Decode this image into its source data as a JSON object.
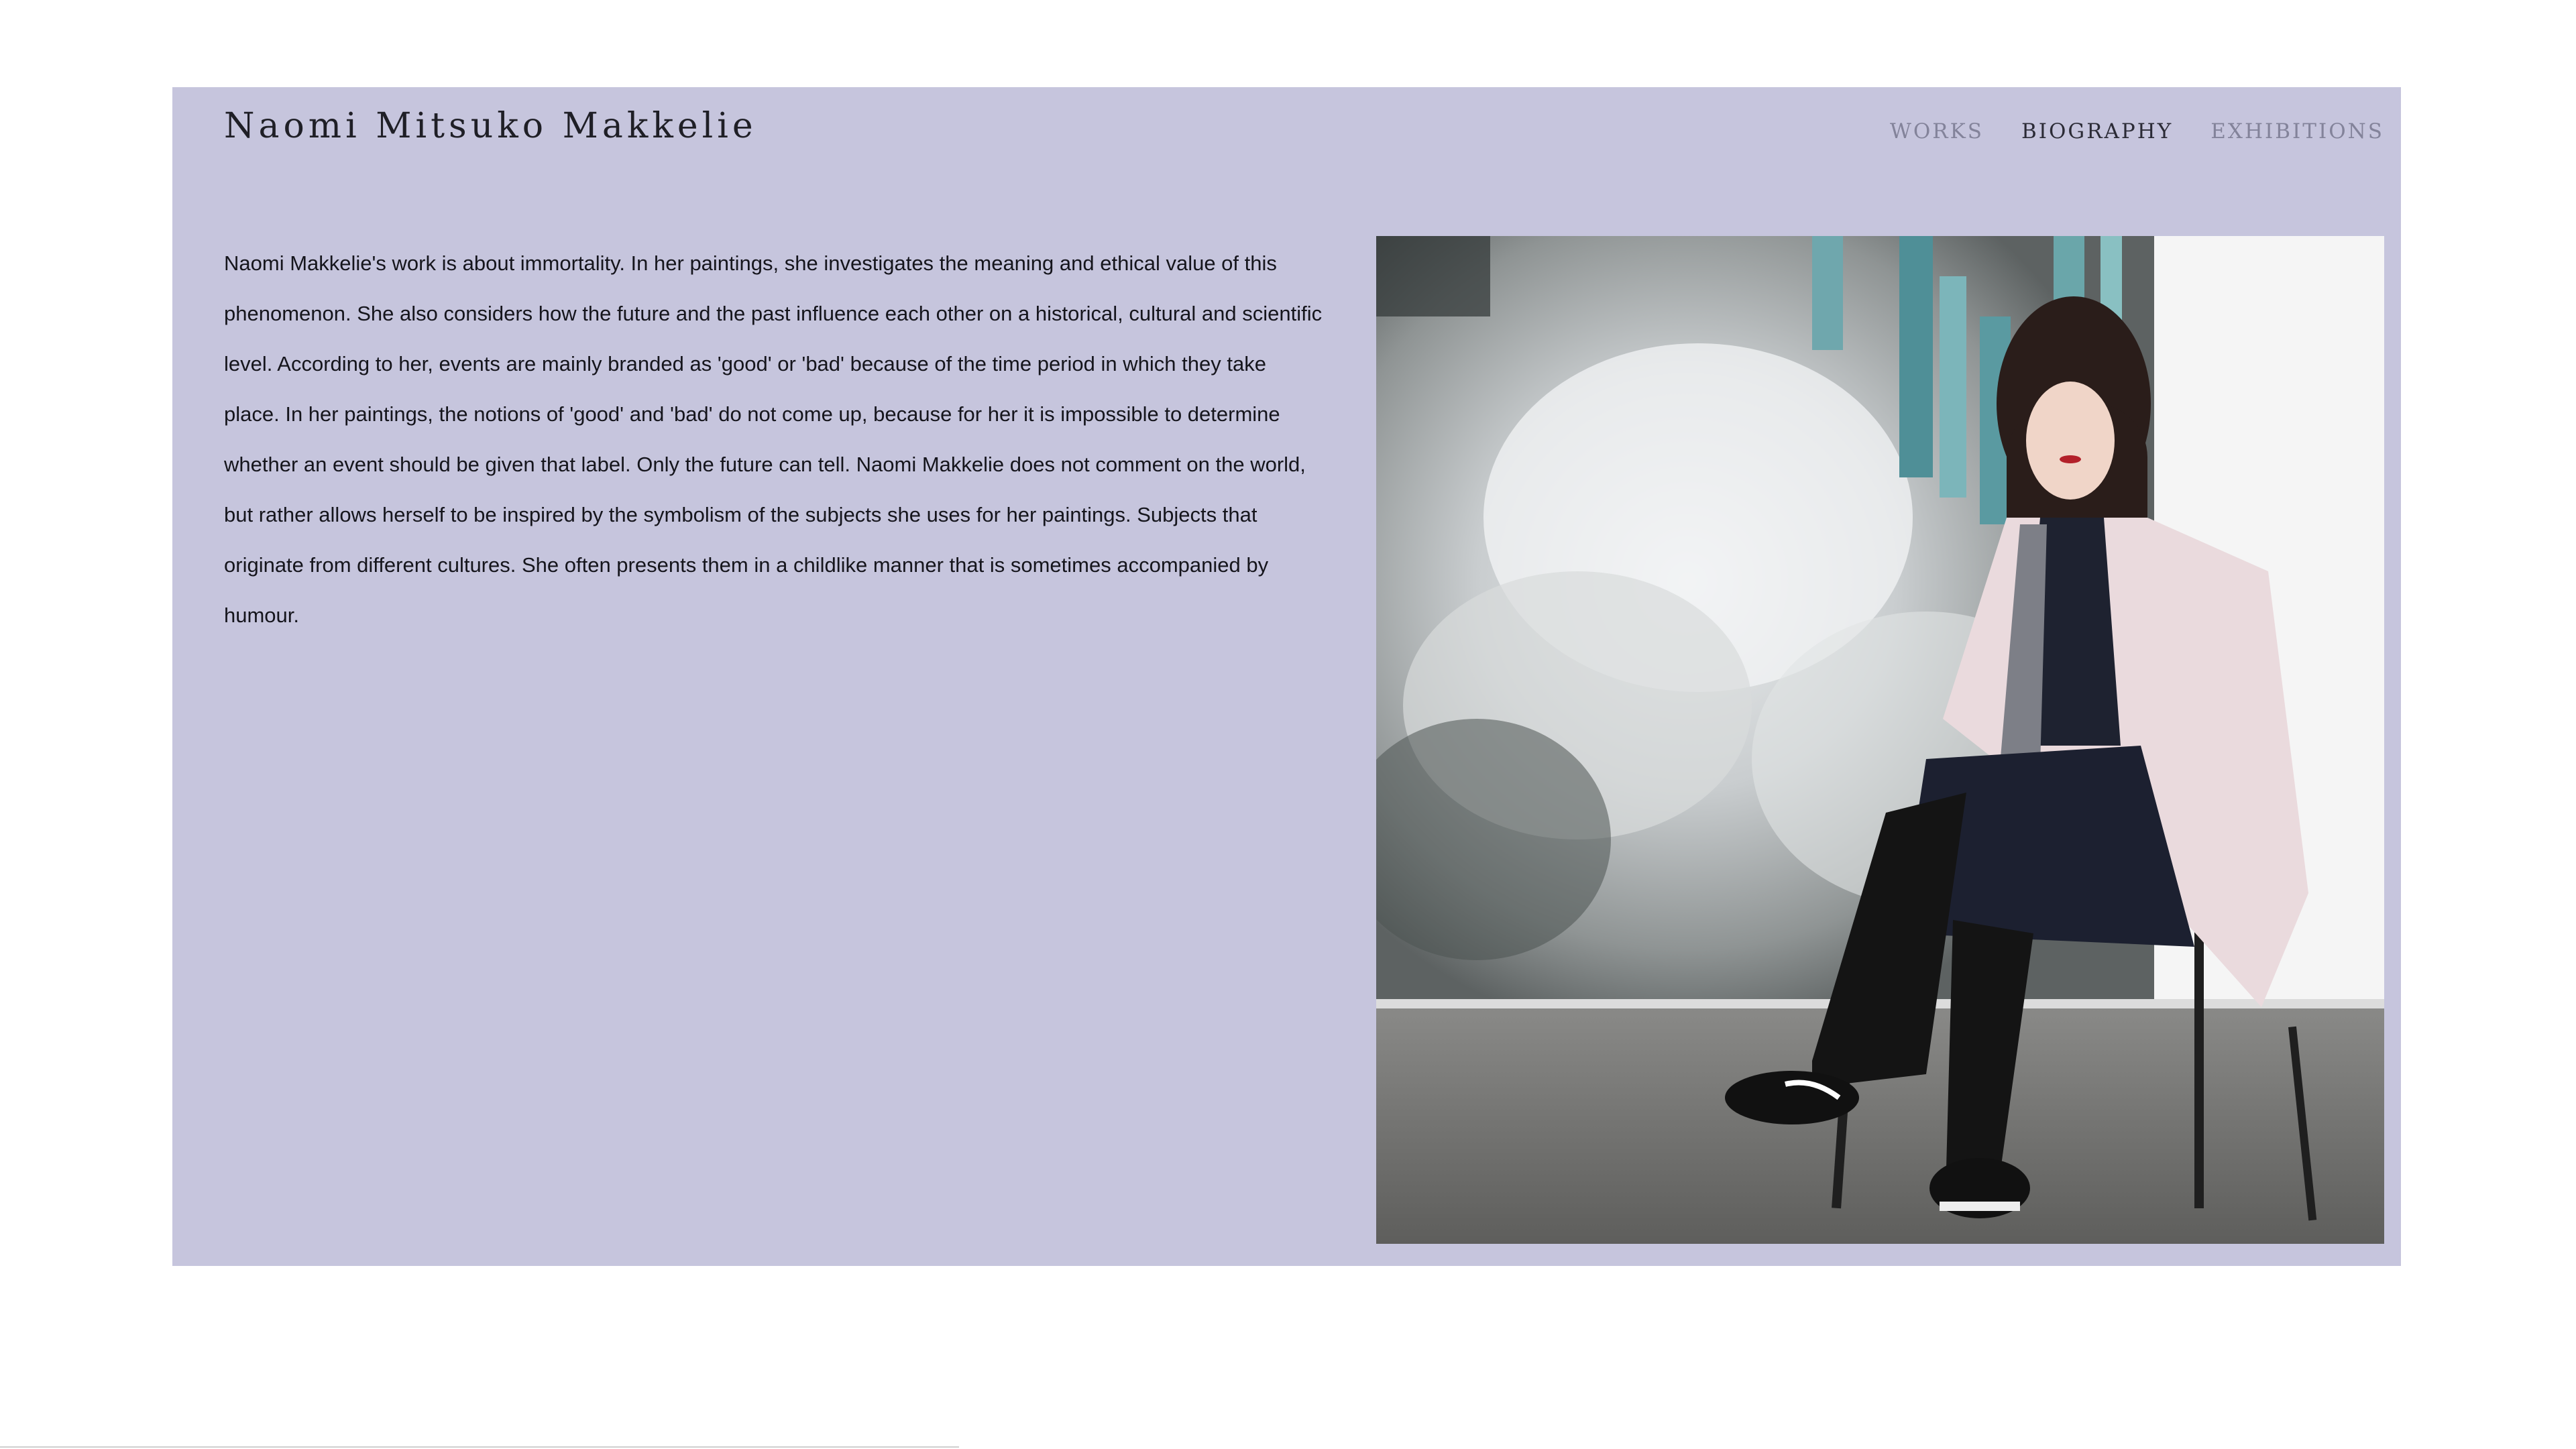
{
  "site": {
    "title": "Naomi Mitsuko Makkelie"
  },
  "nav": {
    "items": [
      {
        "label": "WORKS",
        "active": false
      },
      {
        "label": "BIOGRAPHY",
        "active": true
      },
      {
        "label": "EXHIBITIONS",
        "active": false
      }
    ]
  },
  "biography": {
    "text": "Naomi Makkelie's work is about immortality. In her paintings, she investigates the meaning and ethical value of this phenomenon. She also considers how the future and the past influence each other on a historical, cultural and scientific level. According to her, events are mainly branded as 'good' or 'bad' because of the time period in which they take place. In her paintings, the notions of 'good' and 'bad' do not come up, because for her it is impossible to determine whether an event should be given that label. Only the future can tell. Naomi Makkelie does not comment on the world, but rather allows herself to be inspired by the symbolism of the subjects she uses for her paintings. Subjects that originate from different cultures. She often presents them in a childlike manner that is sometimes accompanied by humour."
  },
  "colors": {
    "panel_background": "#c6c5dd",
    "page_background": "#ffffff",
    "nav_inactive": "#83839a",
    "nav_active": "#2b2b36"
  }
}
